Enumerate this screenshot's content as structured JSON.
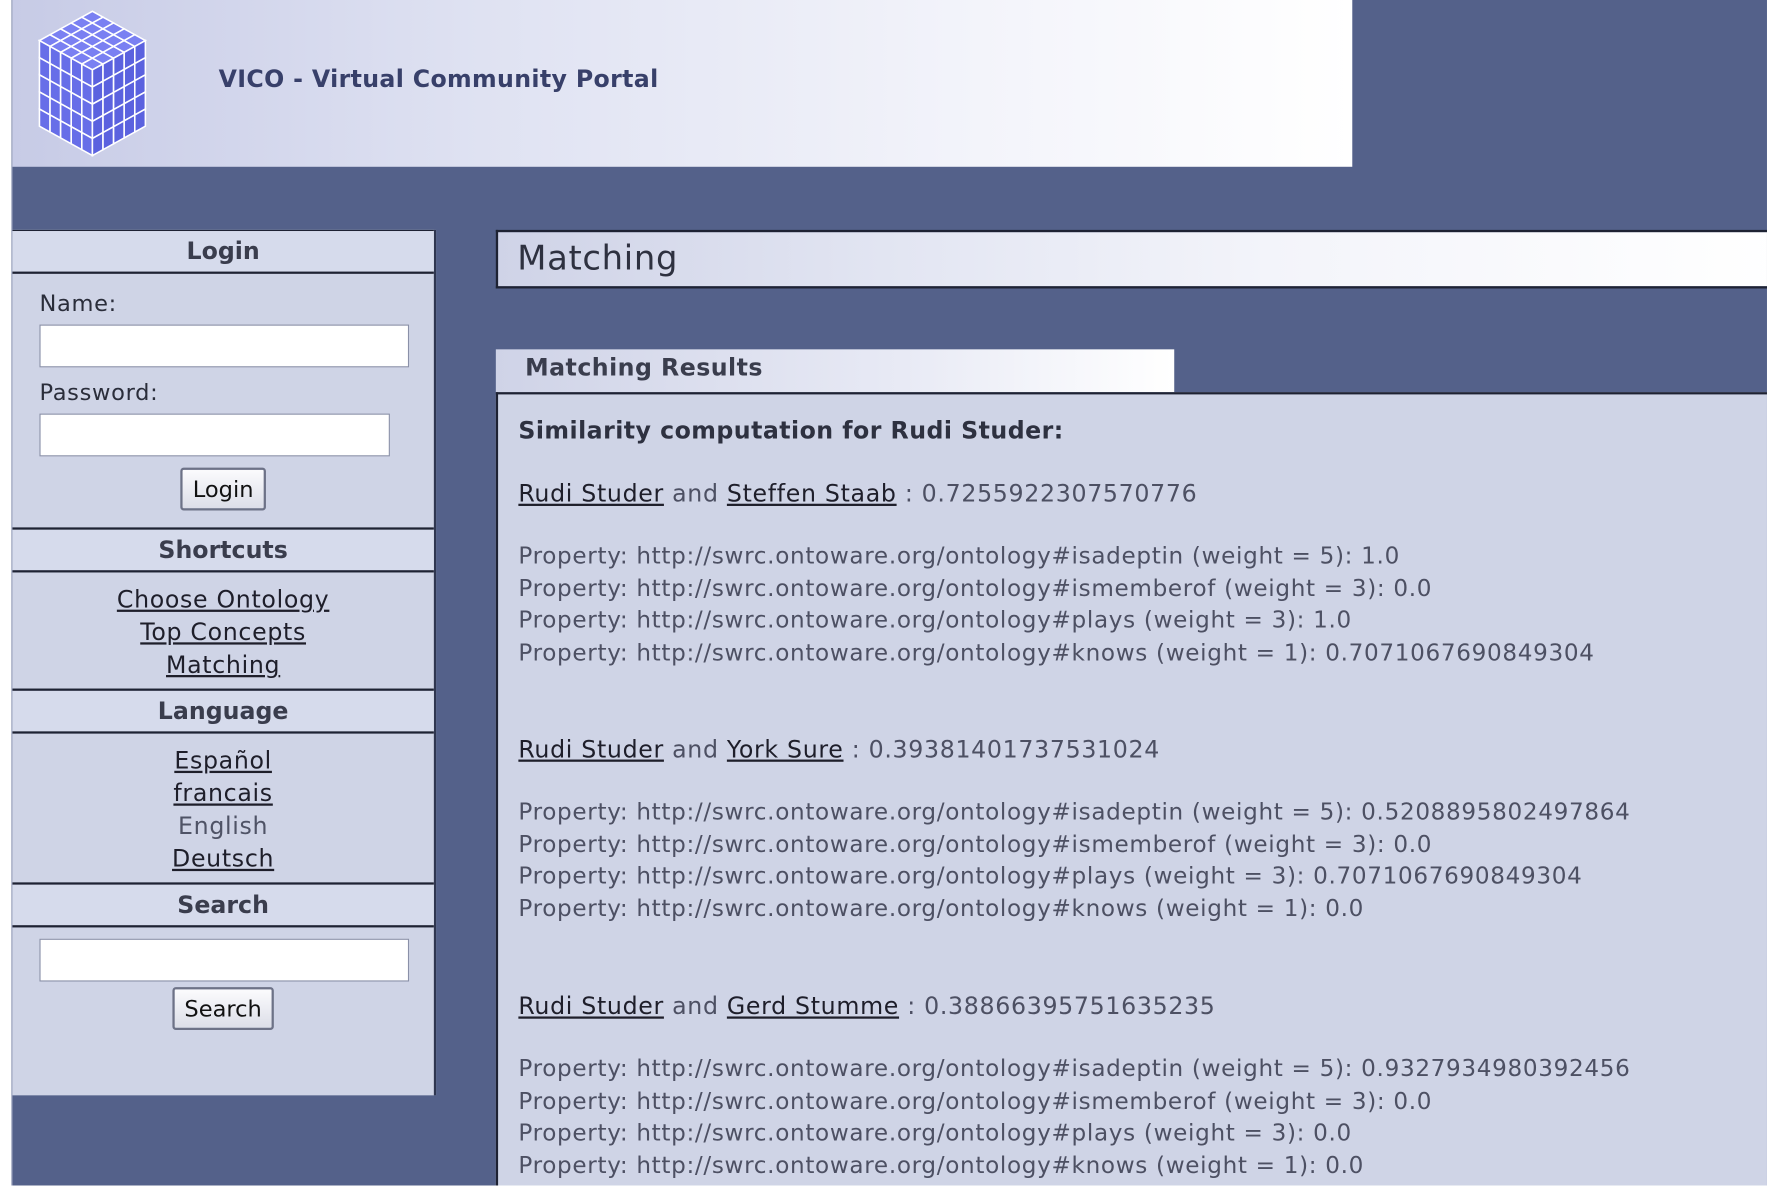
{
  "app": {
    "title": "VICO - Virtual Community Portal",
    "logo": "cube-logo"
  },
  "colors": {
    "page_bg": "#54618a",
    "panel_bg": "#cfd4e6",
    "logo_blue": "#6d74f0"
  },
  "sidebar": {
    "login": {
      "title": "Login",
      "name_label": "Name:",
      "name_value": "",
      "password_label": "Password:",
      "password_value": "",
      "button": "Login"
    },
    "shortcuts": {
      "title": "Shortcuts",
      "links": [
        "Choose Ontology",
        "Top Concepts",
        "Matching"
      ]
    },
    "language": {
      "title": "Language",
      "options": [
        "Español",
        "francais",
        "English",
        "Deutsch"
      ],
      "current": "English"
    },
    "search": {
      "title": "Search",
      "value": "",
      "button": "Search"
    }
  },
  "main": {
    "title": "Matching",
    "tab": "Matching Results",
    "heading": "Similarity computation for Rudi Studer:",
    "and_word": "and",
    "separator": ":",
    "property_label": "Property:",
    "matches": [
      {
        "person_a": "Rudi Studer",
        "person_b": "Steffen Staab",
        "score": "0.7255922307570776",
        "properties": [
          {
            "uri": "http://swrc.ontoware.org/ontology#isadeptin",
            "weight": "(weight = 5):",
            "value": "1.0"
          },
          {
            "uri": "http://swrc.ontoware.org/ontology#ismemberof",
            "weight": "(weight = 3):",
            "value": "0.0"
          },
          {
            "uri": "http://swrc.ontoware.org/ontology#plays",
            "weight": "(weight = 3):",
            "value": "1.0"
          },
          {
            "uri": "http://swrc.ontoware.org/ontology#knows",
            "weight": "(weight = 1):",
            "value": "0.7071067690849304"
          }
        ]
      },
      {
        "person_a": "Rudi Studer",
        "person_b": "York Sure",
        "score": "0.39381401737531024",
        "properties": [
          {
            "uri": "http://swrc.ontoware.org/ontology#isadeptin",
            "weight": "(weight = 5):",
            "value": "0.5208895802497864"
          },
          {
            "uri": "http://swrc.ontoware.org/ontology#ismemberof",
            "weight": "(weight = 3):",
            "value": "0.0"
          },
          {
            "uri": "http://swrc.ontoware.org/ontology#plays",
            "weight": "(weight = 3):",
            "value": "0.7071067690849304"
          },
          {
            "uri": "http://swrc.ontoware.org/ontology#knows",
            "weight": "(weight = 1):",
            "value": "0.0"
          }
        ]
      },
      {
        "person_a": "Rudi Studer",
        "person_b": "Gerd Stumme",
        "score": "0.38866395751635235",
        "properties": [
          {
            "uri": "http://swrc.ontoware.org/ontology#isadeptin",
            "weight": "(weight = 5):",
            "value": "0.9327934980392456"
          },
          {
            "uri": "http://swrc.ontoware.org/ontology#ismemberof",
            "weight": "(weight = 3):",
            "value": "0.0"
          },
          {
            "uri": "http://swrc.ontoware.org/ontology#plays",
            "weight": "(weight = 3):",
            "value": "0.0"
          },
          {
            "uri": "http://swrc.ontoware.org/ontology#knows",
            "weight": "(weight = 1):",
            "value": "0.0"
          }
        ]
      }
    ]
  }
}
